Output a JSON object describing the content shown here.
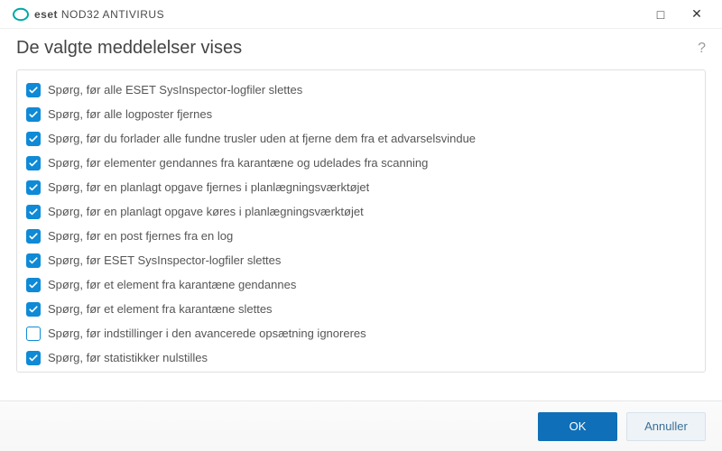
{
  "brand": {
    "eset": "eset",
    "product": "NOD32 ANTIVIRUS"
  },
  "window": {
    "maximize_glyph": "□",
    "close_glyph": "✕",
    "help_glyph": "?"
  },
  "page": {
    "title": "De valgte meddelelser vises"
  },
  "items": [
    {
      "checked": true,
      "label": "Spørg, før alle ESET SysInspector-logfiler slettes"
    },
    {
      "checked": true,
      "label": "Spørg, før alle logposter fjernes"
    },
    {
      "checked": true,
      "label": "Spørg, før du forlader alle fundne trusler uden at fjerne dem fra et advarselsvindue"
    },
    {
      "checked": true,
      "label": "Spørg, før elementer gendannes fra karantæne og udelades fra scanning"
    },
    {
      "checked": true,
      "label": "Spørg, før en planlagt opgave fjernes i planlægningsværktøjet"
    },
    {
      "checked": true,
      "label": "Spørg, før en planlagt opgave køres i planlægningsværktøjet"
    },
    {
      "checked": true,
      "label": "Spørg, før en post fjernes fra en log"
    },
    {
      "checked": true,
      "label": "Spørg, før ESET SysInspector-logfiler slettes"
    },
    {
      "checked": true,
      "label": "Spørg, før et element fra karantæne gendannes"
    },
    {
      "checked": true,
      "label": "Spørg, før et element fra karantæne slettes"
    },
    {
      "checked": false,
      "label": "Spørg, før indstillinger i den avancerede opsætning ignoreres"
    },
    {
      "checked": true,
      "label": "Spørg, før statistikker nulstilles"
    }
  ],
  "footer": {
    "ok": "OK",
    "cancel": "Annuller"
  },
  "colors": {
    "accent": "#0f8ad6",
    "primary_btn": "#0f6fb8"
  }
}
